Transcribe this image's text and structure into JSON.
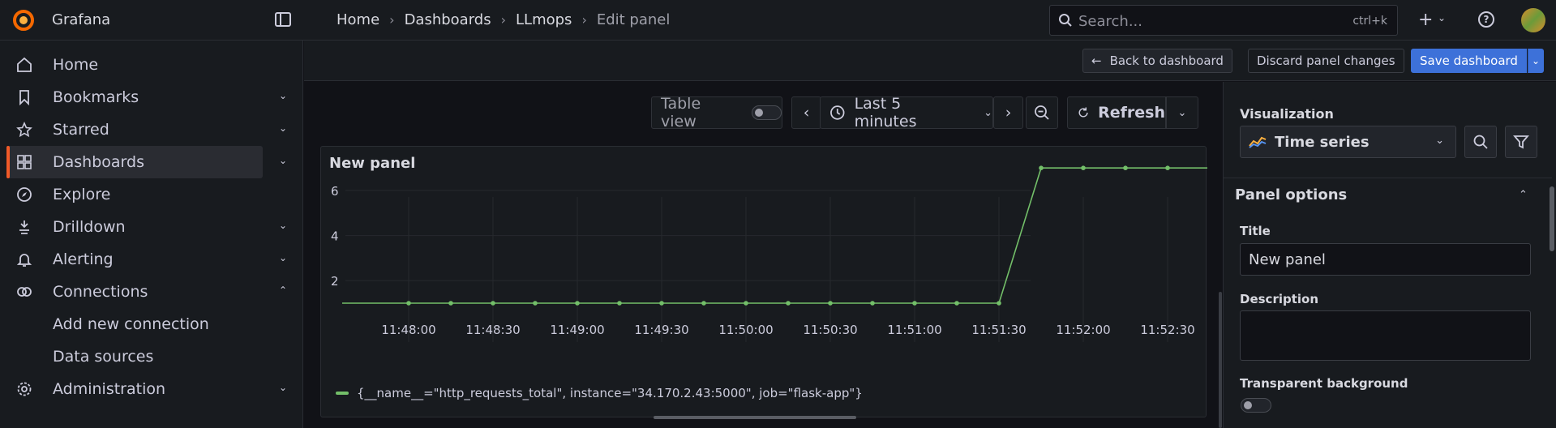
{
  "app": {
    "brand": "Grafana"
  },
  "breadcrumbs": [
    "Home",
    "Dashboards",
    "LLmops",
    "Edit panel"
  ],
  "search": {
    "placeholder": "Search...",
    "shortcut": "ctrl+k"
  },
  "sidebar": {
    "items": [
      {
        "label": "Home",
        "icon": "home-icon"
      },
      {
        "label": "Bookmarks",
        "icon": "bookmark-icon",
        "chevron": "down"
      },
      {
        "label": "Starred",
        "icon": "star-icon",
        "chevron": "down"
      },
      {
        "label": "Dashboards",
        "icon": "apps-icon",
        "chevron": "down",
        "active": true
      },
      {
        "label": "Explore",
        "icon": "compass-icon"
      },
      {
        "label": "Drilldown",
        "icon": "drilldown-icon",
        "chevron": "down"
      },
      {
        "label": "Alerting",
        "icon": "bell-icon",
        "chevron": "down"
      },
      {
        "label": "Connections",
        "icon": "link-icon",
        "chevron": "up"
      },
      {
        "label": "Add new connection",
        "sub": true
      },
      {
        "label": "Data sources",
        "sub": true
      },
      {
        "label": "Administration",
        "icon": "gear-icon",
        "chevron": "down"
      }
    ]
  },
  "toolbar": {
    "back": "Back to dashboard",
    "discard": "Discard panel changes",
    "save": "Save dashboard"
  },
  "panel_toolbar": {
    "table_view": "Table view",
    "time_range": "Last 5 minutes",
    "refresh": "Refresh"
  },
  "panel": {
    "title": "New panel",
    "legend": "{__name__=\"http_requests_total\", instance=\"34.170.2.43:5000\", job=\"flask-app\"}"
  },
  "chart_data": {
    "type": "line",
    "x": [
      "11:47:45",
      "11:48:00",
      "11:48:15",
      "11:48:30",
      "11:48:45",
      "11:49:00",
      "11:49:15",
      "11:49:30",
      "11:49:45",
      "11:50:00",
      "11:50:15",
      "11:50:30",
      "11:50:45",
      "11:51:00",
      "11:51:15",
      "11:51:30",
      "11:51:45",
      "11:52:00",
      "11:52:15",
      "11:52:30",
      "11:52:45"
    ],
    "x_ticks": [
      "11:48:00",
      "11:48:30",
      "11:49:00",
      "11:49:30",
      "11:50:00",
      "11:50:30",
      "11:51:00",
      "11:51:30",
      "11:52:00",
      "11:52:30"
    ],
    "y_ticks": [
      2,
      4,
      6
    ],
    "ylim": [
      0,
      7.8
    ],
    "series": [
      {
        "name": "{__name__=\"http_requests_total\", instance=\"34.170.2.43:5000\", job=\"flask-app\"}",
        "values": [
          null,
          1,
          1,
          1,
          1,
          1,
          1,
          1,
          1,
          1,
          1,
          1,
          1,
          1,
          1,
          1,
          7,
          7,
          7,
          7,
          7
        ]
      }
    ],
    "colors": {
      "series": "#73bf69"
    }
  },
  "options": {
    "visualization_label": "Visualization",
    "visualization_value": "Time series",
    "section": "Panel options",
    "title_label": "Title",
    "title_value": "New panel",
    "description_label": "Description",
    "description_value": "",
    "transparent_label": "Transparent background"
  }
}
